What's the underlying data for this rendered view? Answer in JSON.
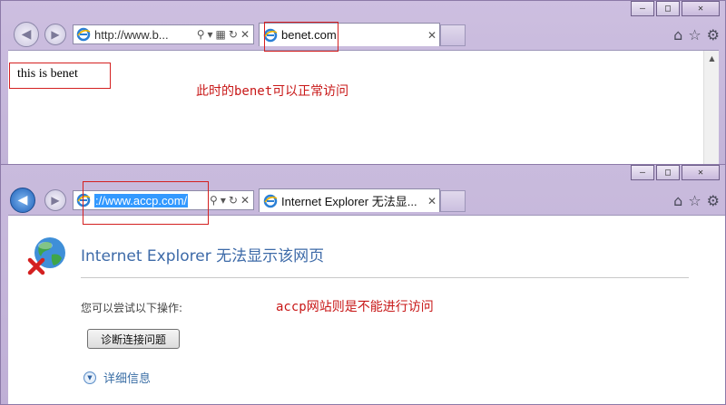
{
  "window_top": {
    "caption_buttons": [
      "–",
      "□",
      "✕"
    ],
    "nav": {
      "back_icon": "back-arrow-icon",
      "forward_icon": "forward-arrow-icon"
    },
    "address": {
      "text": "http://www.b..."
    },
    "tab": {
      "title": "benet.com"
    },
    "page": {
      "body_text": "this is benet"
    }
  },
  "window_bottom": {
    "caption_buttons": [
      "–",
      "□",
      "✕"
    ],
    "address": {
      "selected_text": "://www.accp.com/"
    },
    "tab": {
      "title": "Internet Explorer 无法显..."
    },
    "error_page": {
      "title": "Internet Explorer 无法显示该网页",
      "try_text": "您可以尝试以下操作:",
      "diagnose_button": "诊断连接问题",
      "more_info": "详细信息"
    }
  },
  "annotations": {
    "top_note": "此时的benet可以正常访问",
    "bottom_note": "accp网站则是不能进行访问"
  },
  "colors": {
    "frame": "#c9bbdd",
    "annotation": "#c81818",
    "error_title": "#3d6aa8",
    "selection": "#3399ff"
  }
}
